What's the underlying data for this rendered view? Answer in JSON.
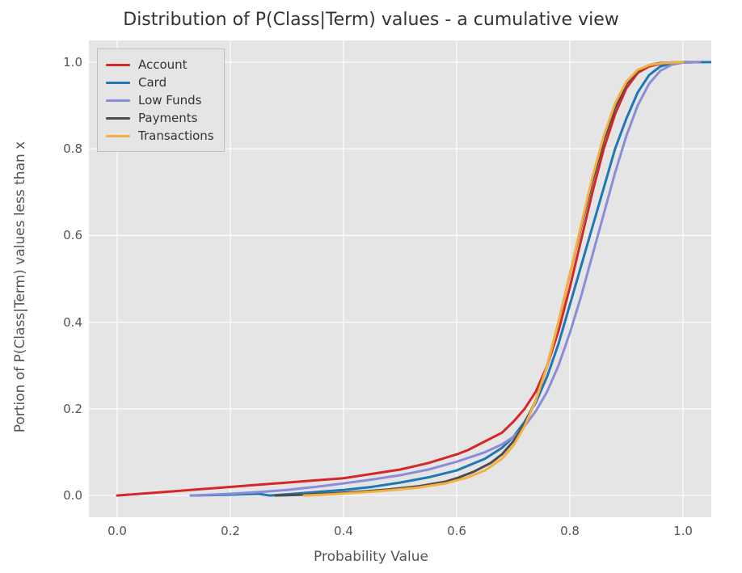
{
  "chart_data": {
    "type": "line",
    "title": "Distribution of P(Class|Term) values - a cumulative view",
    "xlabel": "Probability Value",
    "ylabel": "Portion of P(Class|Term) values less than x",
    "xlim": [
      -0.05,
      1.05
    ],
    "ylim": [
      -0.05,
      1.05
    ],
    "xticks": [
      0.0,
      0.2,
      0.4,
      0.6,
      0.8,
      1.0
    ],
    "yticks": [
      0.0,
      0.2,
      0.4,
      0.6,
      0.8,
      1.0
    ],
    "legend_position": "upper left",
    "series": [
      {
        "name": "Account",
        "color": "#d62728",
        "x": [
          0.0,
          0.05,
          0.1,
          0.15,
          0.2,
          0.25,
          0.3,
          0.35,
          0.4,
          0.45,
          0.5,
          0.55,
          0.6,
          0.62,
          0.65,
          0.68,
          0.7,
          0.72,
          0.74,
          0.76,
          0.78,
          0.8,
          0.82,
          0.84,
          0.86,
          0.88,
          0.9,
          0.92,
          0.94,
          0.96,
          0.98,
          1.0,
          1.03
        ],
        "y": [
          0.0,
          0.005,
          0.01,
          0.015,
          0.02,
          0.025,
          0.03,
          0.035,
          0.04,
          0.05,
          0.06,
          0.075,
          0.095,
          0.105,
          0.125,
          0.145,
          0.17,
          0.2,
          0.24,
          0.3,
          0.38,
          0.48,
          0.59,
          0.7,
          0.8,
          0.88,
          0.94,
          0.975,
          0.99,
          0.996,
          0.999,
          1.0,
          1.0
        ]
      },
      {
        "name": "Card",
        "color": "#1f77b4",
        "x": [
          0.13,
          0.2,
          0.25,
          0.27,
          0.3,
          0.35,
          0.4,
          0.45,
          0.5,
          0.55,
          0.6,
          0.65,
          0.68,
          0.7,
          0.72,
          0.74,
          0.76,
          0.78,
          0.8,
          0.82,
          0.84,
          0.86,
          0.88,
          0.9,
          0.92,
          0.94,
          0.96,
          0.98,
          1.0,
          1.03,
          1.05
        ],
        "y": [
          0.0,
          0.002,
          0.004,
          0.0,
          0.003,
          0.008,
          0.013,
          0.02,
          0.03,
          0.042,
          0.058,
          0.085,
          0.11,
          0.135,
          0.17,
          0.215,
          0.275,
          0.35,
          0.44,
          0.53,
          0.62,
          0.71,
          0.8,
          0.87,
          0.93,
          0.97,
          0.99,
          0.997,
          0.999,
          1.0,
          1.0
        ]
      },
      {
        "name": "Low Funds",
        "color": "#8b8cd9",
        "x": [
          0.13,
          0.2,
          0.25,
          0.3,
          0.35,
          0.4,
          0.45,
          0.5,
          0.55,
          0.6,
          0.65,
          0.68,
          0.7,
          0.72,
          0.74,
          0.76,
          0.78,
          0.8,
          0.82,
          0.84,
          0.86,
          0.88,
          0.9,
          0.92,
          0.94,
          0.96,
          0.98,
          1.0,
          1.03
        ],
        "y": [
          0.0,
          0.004,
          0.008,
          0.013,
          0.02,
          0.028,
          0.037,
          0.047,
          0.06,
          0.078,
          0.1,
          0.118,
          0.135,
          0.16,
          0.195,
          0.24,
          0.3,
          0.375,
          0.46,
          0.555,
          0.65,
          0.745,
          0.83,
          0.9,
          0.95,
          0.98,
          0.994,
          0.999,
          1.0
        ]
      },
      {
        "name": "Payments",
        "color": "#4d4d4d",
        "x": [
          0.28,
          0.33,
          0.38,
          0.43,
          0.48,
          0.53,
          0.58,
          0.6,
          0.63,
          0.66,
          0.68,
          0.7,
          0.72,
          0.74,
          0.76,
          0.78,
          0.8,
          0.82,
          0.84,
          0.86,
          0.88,
          0.9,
          0.92,
          0.94,
          0.96,
          0.98,
          1.0
        ],
        "y": [
          0.0,
          0.002,
          0.005,
          0.009,
          0.014,
          0.021,
          0.032,
          0.04,
          0.055,
          0.075,
          0.095,
          0.125,
          0.165,
          0.22,
          0.3,
          0.4,
          0.51,
          0.62,
          0.725,
          0.82,
          0.895,
          0.95,
          0.98,
          0.993,
          0.998,
          0.999,
          1.0
        ]
      },
      {
        "name": "Transactions",
        "color": "#f5b041",
        "x": [
          0.33,
          0.38,
          0.43,
          0.48,
          0.53,
          0.58,
          0.62,
          0.65,
          0.68,
          0.7,
          0.72,
          0.74,
          0.76,
          0.78,
          0.8,
          0.82,
          0.84,
          0.86,
          0.88,
          0.9,
          0.92,
          0.94,
          0.96,
          0.98,
          1.0
        ],
        "y": [
          0.0,
          0.003,
          0.007,
          0.012,
          0.018,
          0.028,
          0.042,
          0.058,
          0.085,
          0.115,
          0.16,
          0.22,
          0.3,
          0.4,
          0.51,
          0.625,
          0.735,
          0.83,
          0.905,
          0.955,
          0.982,
          0.993,
          0.997,
          0.999,
          1.0
        ]
      }
    ]
  }
}
